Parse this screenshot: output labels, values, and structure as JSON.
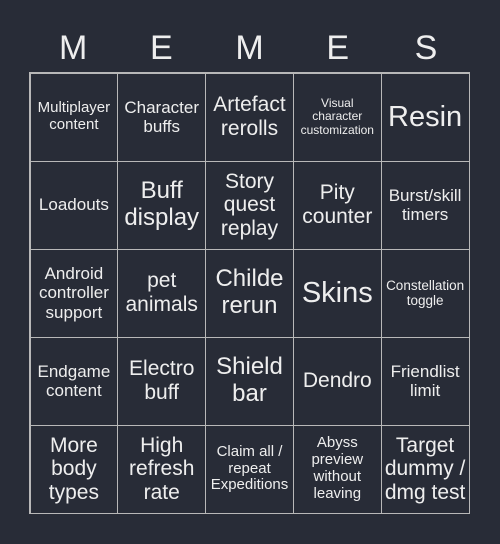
{
  "title_letters": [
    "M",
    "E",
    "M",
    "E",
    "S"
  ],
  "colors": {
    "background": "#282c37",
    "text": "#eeeeee",
    "grid_line": "#b8b8b8"
  },
  "cells": [
    [
      "Multiplayer content",
      "Character buffs",
      "Artefact rerolls",
      "Visual character customization",
      "Resin"
    ],
    [
      "Loadouts",
      "Buff display",
      "Story quest replay",
      "Pity counter",
      "Burst/skill timers"
    ],
    [
      "Android controller support",
      "pet animals",
      "Childe rerun",
      "Skins",
      "Constellation toggle"
    ],
    [
      "Endgame content",
      "Electro buff",
      "Shield bar",
      "Dendro",
      "Friendlist limit"
    ],
    [
      "More body types",
      "High refresh rate",
      "Claim all / repeat Expeditions",
      "Abyss preview without leaving",
      "Target dummy / dmg test"
    ]
  ]
}
